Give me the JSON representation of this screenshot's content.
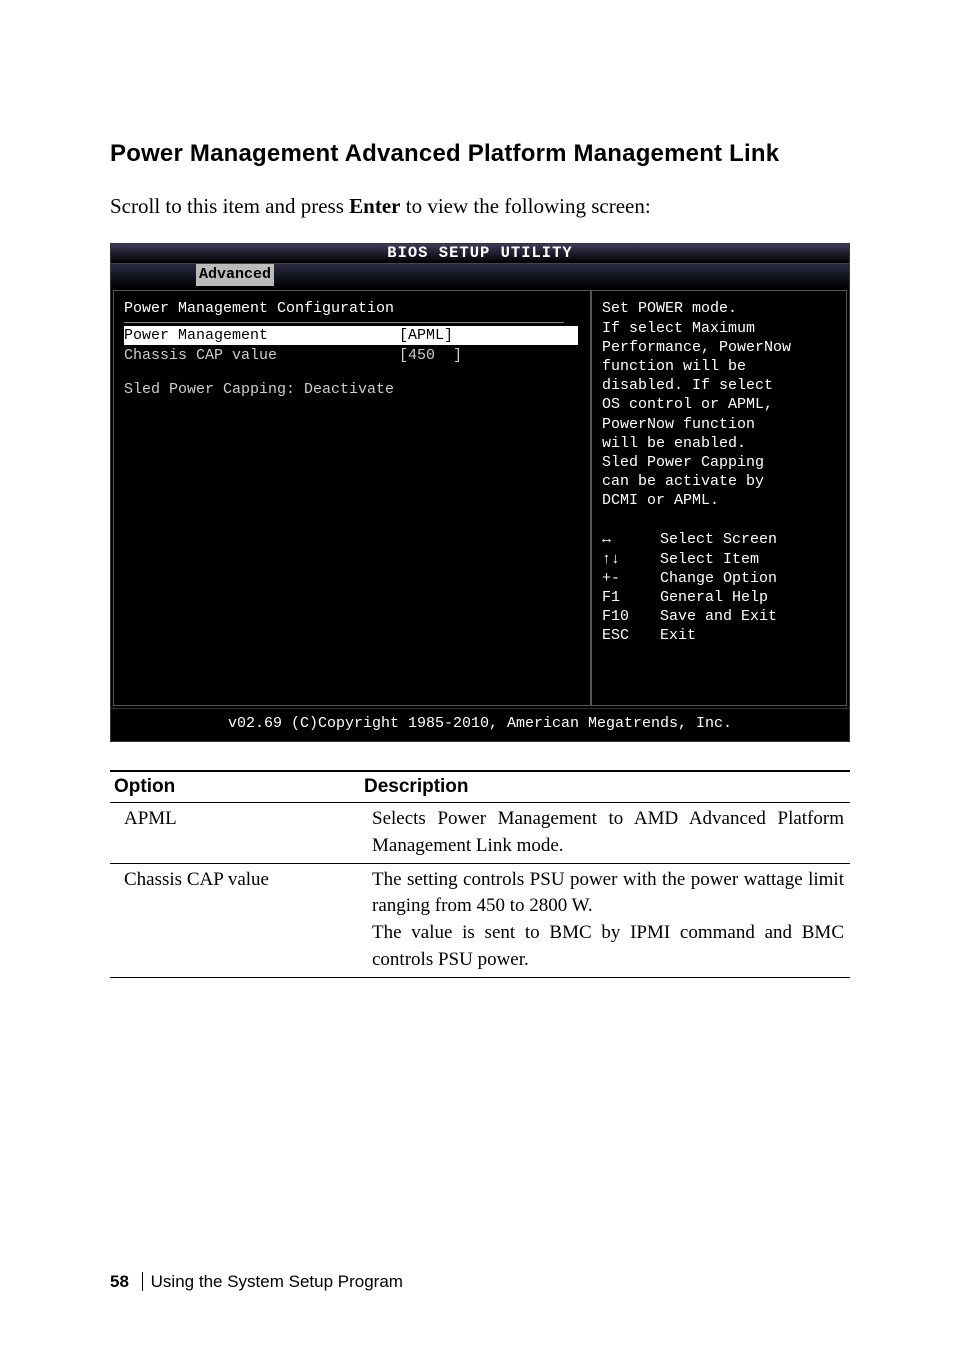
{
  "heading": "Power Management Advanced Platform Management Link",
  "intro": {
    "prefix": "Scroll to this item and press ",
    "bold": "Enter",
    "suffix": " to view the following screen:"
  },
  "bios": {
    "title": "BIOS SETUP UTILITY",
    "active_tab": "Advanced",
    "section_title": "Power Management Configuration",
    "rows": [
      {
        "label": "Power Management",
        "value": "[APML]",
        "highlight": true
      },
      {
        "label": "Chassis CAP value",
        "value": "[450  ]",
        "highlight": false
      }
    ],
    "status_line": "Sled Power Capping: Deactivate",
    "help_text": "Set POWER mode.\nIf select Maximum\nPerformance, PowerNow\nfunction will be\ndisabled. If select\nOS control or APML,\nPowerNow function\nwill be enabled.\nSled Power Capping\ncan be activate by\nDCMI or APML.",
    "nav": [
      {
        "key": "↔",
        "label": "Select Screen"
      },
      {
        "key": "↑↓",
        "label": "Select Item"
      },
      {
        "key": "+-",
        "label": "Change Option"
      },
      {
        "key": "F1",
        "label": "General Help"
      },
      {
        "key": "F10",
        "label": "Save and Exit"
      },
      {
        "key": "ESC",
        "label": "Exit"
      }
    ],
    "footer": "v02.69 (C)Copyright 1985-2010, American Megatrends, Inc."
  },
  "options_table": {
    "headers": [
      "Option",
      "Description"
    ],
    "rows": [
      {
        "option": "APML",
        "description": "Selects Power Management to AMD Advanced Platform Management Link mode."
      },
      {
        "option": "Chassis CAP value",
        "description": "The setting controls PSU power with the power wattage limit ranging from 450 to 2800 W.\nThe value is sent to BMC by IPMI command and BMC controls PSU power."
      }
    ]
  },
  "footer": {
    "page": "58",
    "section": "Using the System Setup Program"
  }
}
